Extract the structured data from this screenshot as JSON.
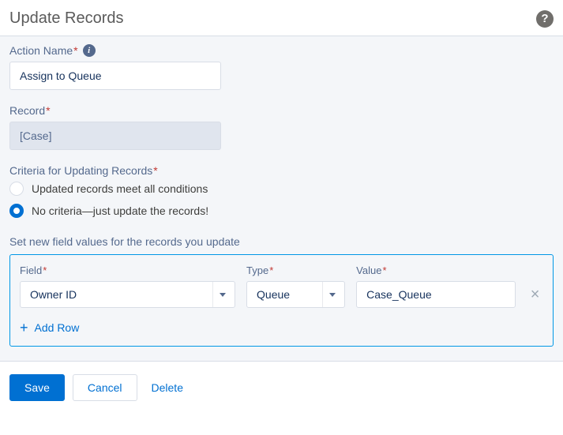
{
  "header": {
    "title": "Update Records"
  },
  "form": {
    "actionName": {
      "label": "Action Name",
      "value": "Assign to Queue"
    },
    "record": {
      "label": "Record",
      "value": "[Case]"
    },
    "criteria": {
      "label": "Criteria for Updating Records",
      "options": [
        "Updated records meet all conditions",
        "No criteria—just update the records!"
      ],
      "selectedIndex": 1
    },
    "fieldValues": {
      "sectionLabel": "Set new field values for the records you update",
      "columns": {
        "field": "Field",
        "type": "Type",
        "value": "Value"
      },
      "rows": [
        {
          "field": "Owner ID",
          "type": "Queue",
          "value": "Case_Queue"
        }
      ],
      "addRow": "Add Row"
    }
  },
  "footer": {
    "save": "Save",
    "cancel": "Cancel",
    "delete": "Delete"
  }
}
